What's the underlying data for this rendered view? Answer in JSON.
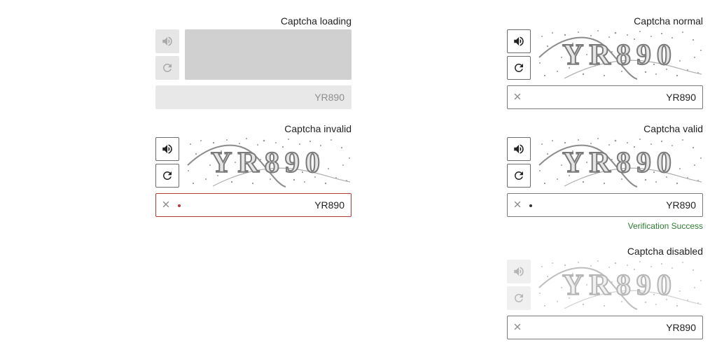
{
  "loading": {
    "title": "Captcha loading",
    "value": "YR890"
  },
  "normal": {
    "title": "Captcha normal",
    "value": "YR890",
    "captcha_text": "YR890"
  },
  "invalid": {
    "title": "Captcha invalid",
    "value": "YR890",
    "captcha_text": "YR890"
  },
  "valid": {
    "title": "Captcha valid",
    "value": "YR890",
    "captcha_text": "YR890",
    "helper": "Verification Success"
  },
  "disabled": {
    "title": "Captcha disabled",
    "value": "YR890",
    "captcha_text": "YR890"
  },
  "icons": {
    "audio": "speaker-icon",
    "refresh": "refresh-icon",
    "clear": "clear-icon"
  },
  "colors": {
    "invalid_border": "#b23a3a",
    "success_text": "#2e7d32",
    "loading_fill": "#d0d0d0",
    "invalid_dot": "#b23a3a",
    "valid_dot": "#333333"
  }
}
